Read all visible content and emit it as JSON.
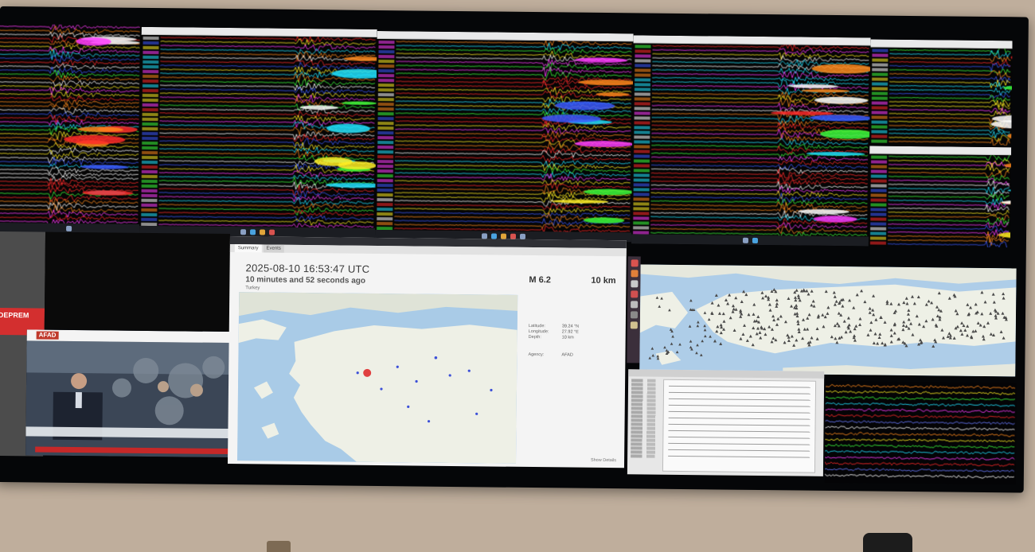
{
  "event": {
    "tabs": [
      "Summary",
      "Events"
    ],
    "origin_time": "2025-08-10 16:53:47 UTC",
    "elapsed": "10 minutes and 52 seconds ago",
    "region": "Turkey",
    "magnitude": "M 6.2",
    "depth": "10 km",
    "latitude_label": "Latitude:",
    "latitude_value": "39.24 °N",
    "longitude_label": "Longitude:",
    "longitude_value": "27.92 °E",
    "depth_label": "Depth:",
    "depth_value": "10 km",
    "agency_label": "Agency:",
    "agency_value": "AFAD",
    "show_details": "Show Details"
  },
  "tv": {
    "channel_logo": "AFAD"
  },
  "news": {
    "headline": "DEPREM"
  },
  "colors": {
    "trace_palette": [
      "#ff2a2a",
      "#ffffff",
      "#3cff3c",
      "#ff8a1c",
      "#21e3ff",
      "#ff3cff",
      "#ffee22",
      "#3c5aff"
    ],
    "alert_red": "#d32f2f",
    "map_water": "#a9cbe7",
    "map_land": "#eef0e6"
  }
}
